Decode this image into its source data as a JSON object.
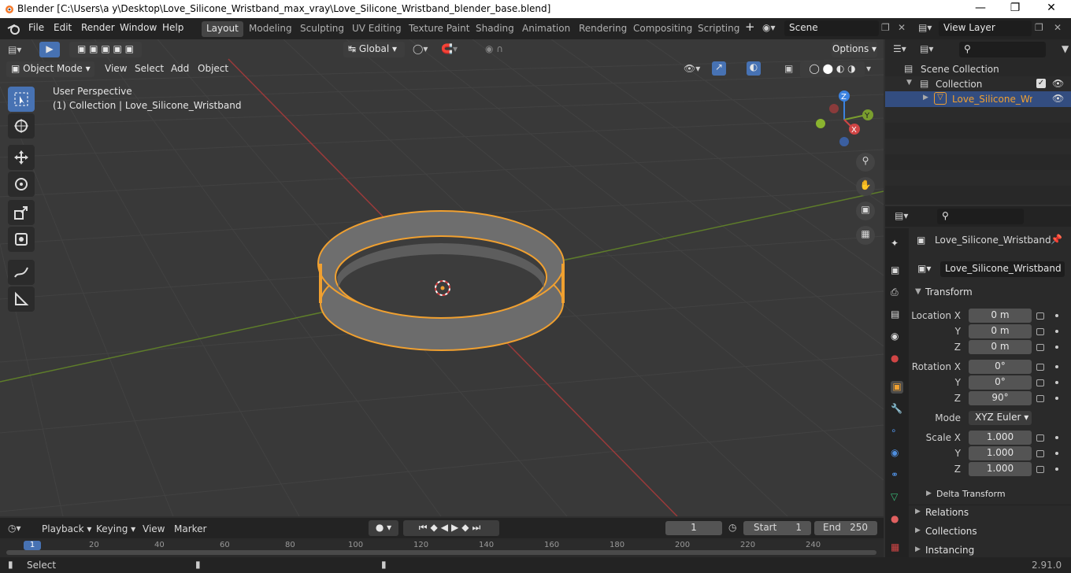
{
  "window": {
    "title": "Blender [C:\\Users\\a y\\Desktop\\Love_Silicone_Wristband_max_vray\\Love_Silicone_Wristband_blender_base.blend]",
    "minimize": "—",
    "maximize": "❐",
    "close": "✕"
  },
  "menu": {
    "file": "File",
    "edit": "Edit",
    "render": "Render",
    "window": "Window",
    "help": "Help"
  },
  "workspaces": [
    "Layout",
    "Modeling",
    "Sculpting",
    "UV Editing",
    "Texture Paint",
    "Shading",
    "Animation",
    "Rendering",
    "Compositing",
    "Scripting"
  ],
  "scene": {
    "label": "Scene",
    "viewlayer": "View Layer"
  },
  "header": {
    "orientation": "Global",
    "options": "Options",
    "mode": "Object Mode",
    "view": "View",
    "select": "Select",
    "add": "Add",
    "object": "Object"
  },
  "viewport": {
    "perspective": "User Perspective",
    "collection_info": "(1) Collection | Love_Silicone_Wristband",
    "gizmo": {
      "x": "X",
      "y": "Y",
      "z": "Z"
    }
  },
  "outliner": {
    "scene_collection": "Scene Collection",
    "collection": "Collection",
    "object": "Love_Silicone_Wristband"
  },
  "properties": {
    "object_name": "Love_Silicone_Wristband",
    "name_field": "Love_Silicone_Wristband",
    "transform": "Transform",
    "location_label": "Location X",
    "y_label": "Y",
    "z_label": "Z",
    "location": [
      "0 m",
      "0 m",
      "0 m"
    ],
    "rotation_label": "Rotation X",
    "rotation": [
      "0°",
      "0°",
      "90°"
    ],
    "mode_label": "Mode",
    "mode": "XYZ Euler",
    "scale_label": "Scale X",
    "scale": [
      "1.000",
      "1.000",
      "1.000"
    ],
    "delta": "Delta Transform",
    "relations": "Relations",
    "collections": "Collections",
    "instancing": "Instancing"
  },
  "timeline": {
    "playback": "Playback",
    "keying": "Keying",
    "view": "View",
    "marker": "Marker",
    "current_frame": "1",
    "start_label": "Start",
    "start": "1",
    "end_label": "End",
    "end": "250",
    "ticks": [
      "1",
      "20",
      "40",
      "60",
      "80",
      "100",
      "120",
      "140",
      "160",
      "180",
      "200",
      "220",
      "240"
    ]
  },
  "status": {
    "select": "Select",
    "version": "2.91.0"
  },
  "colors": {
    "accent": "#4772b3",
    "selection": "#f0a030",
    "x_axis": "#c24040",
    "y_axis": "#6a9a2a"
  }
}
